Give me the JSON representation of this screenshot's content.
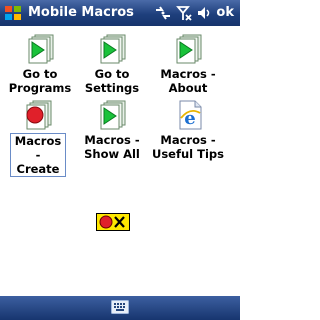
{
  "titlebar": {
    "title": "Mobile Macros",
    "ok_label": "ok"
  },
  "tray_icons": [
    "connectivity-icon",
    "signal-off-icon",
    "volume-icon"
  ],
  "items": [
    {
      "line1": "Go to",
      "line2": "Programs",
      "icon": "macro-play-icon"
    },
    {
      "line1": "Go to",
      "line2": "Settings",
      "icon": "macro-play-icon"
    },
    {
      "line1": "Macros -",
      "line2": "About",
      "icon": "macro-play-icon"
    },
    {
      "line1": "Macros -",
      "line2": "Create",
      "icon": "record-icon"
    },
    {
      "line1": "Macros -",
      "line2": "Show All",
      "icon": "macro-play-icon"
    },
    {
      "line1": "Macros -",
      "line2": "Useful Tips",
      "icon": "internet-explorer-icon"
    }
  ],
  "overlay": {
    "icon": "record-stop-icon"
  },
  "bottom": {
    "icon": "keyboard-icon"
  },
  "colors": {
    "titlebar": "#1e3f7c",
    "accent_green": "#19c23a",
    "record_red": "#e0202a",
    "overlay_yellow": "#ffe800"
  }
}
